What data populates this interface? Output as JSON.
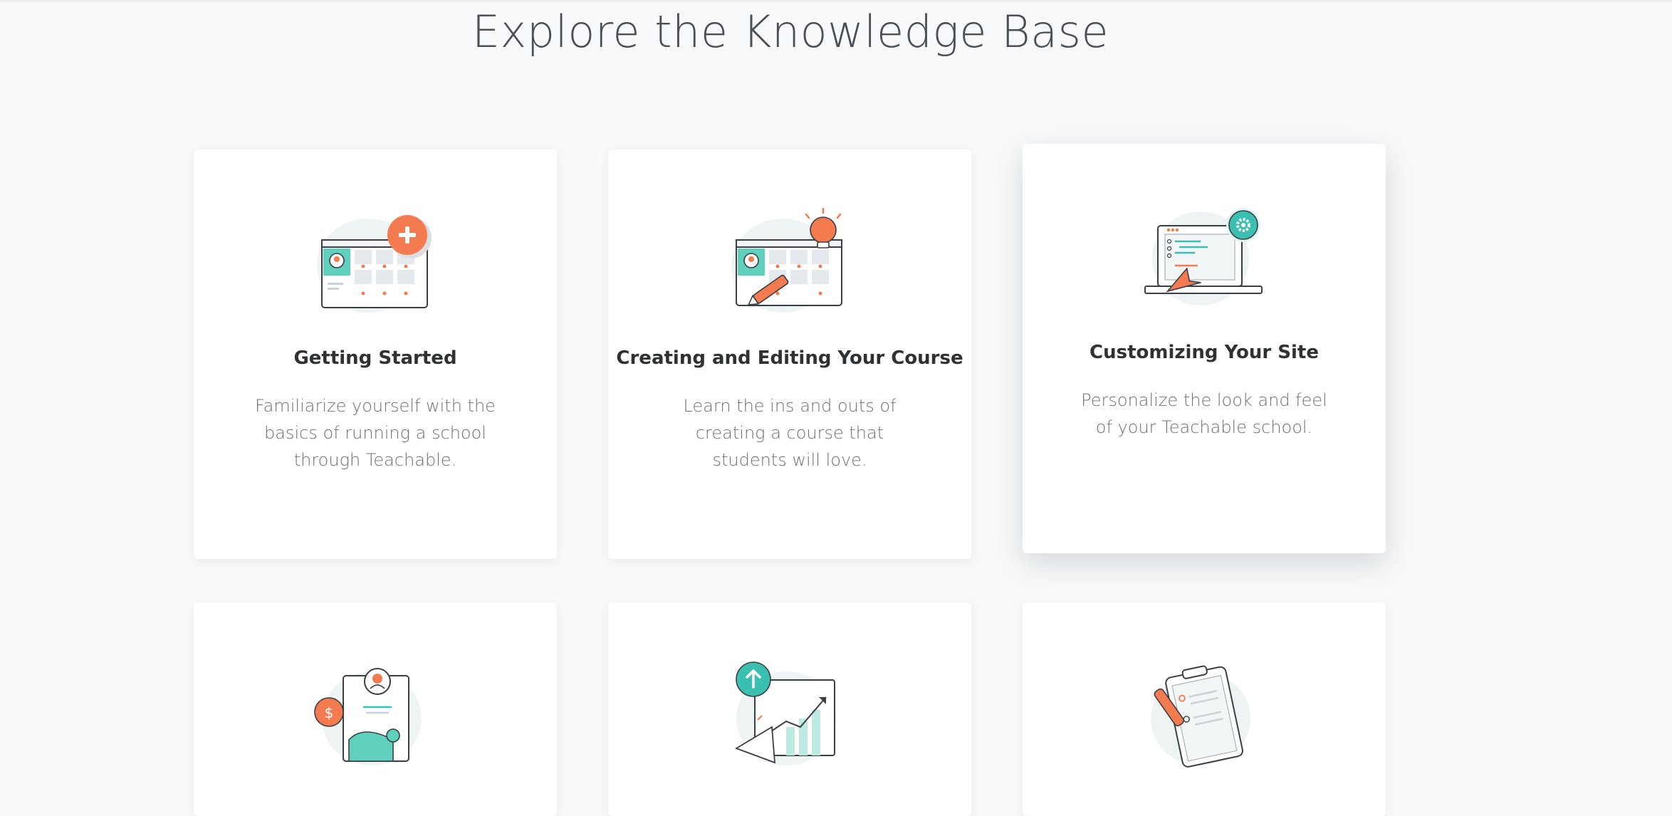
{
  "page": {
    "title": "Explore the Knowledge Base"
  },
  "cards": [
    {
      "title": "Getting Started",
      "description": "Familiarize yourself with the basics of running a school through Teachable.",
      "icon": "course-dashboard-plus-icon"
    },
    {
      "title": "Creating and Editing Your Course",
      "description": "Learn the ins and outs of creating a course that students will love.",
      "icon": "course-editor-lightbulb-icon"
    },
    {
      "title": "Customizing Your Site",
      "description": "Personalize the look and feel of your Teachable school.",
      "icon": "laptop-settings-icon"
    },
    {
      "icon": "student-payment-icon"
    },
    {
      "icon": "marketing-growth-icon"
    },
    {
      "icon": "clipboard-edit-icon"
    }
  ],
  "colors": {
    "background": "#f7f9fa",
    "card": "#ffffff",
    "accent_orange": "#f47b4f",
    "accent_teal": "#3bbfb0",
    "title_text": "#2e3235",
    "body_text": "#6c7075"
  }
}
